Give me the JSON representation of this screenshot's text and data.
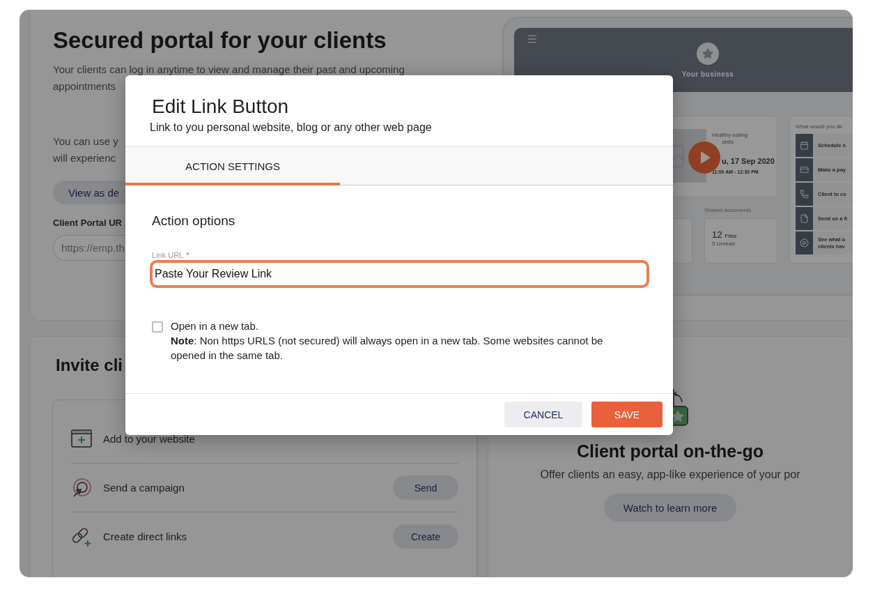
{
  "portal": {
    "title": "Secured portal for your clients",
    "intro_lines": [
      "Your clients can log in anytime to view and manage their past and upcoming",
      "appointments"
    ],
    "usage_lines": [
      "You can use y",
      "will experienc"
    ],
    "demo_button": "View as de",
    "url_label": "Client Portal UR",
    "url_field": {
      "value": "https://emp.th"
    }
  },
  "preview": {
    "business": "Your business",
    "video": {
      "caption_lines": [
        "Healthy eating",
        "abits"
      ],
      "date": "u, 17 Sep 2020",
      "time": "11:00 AM - 12:30 PM"
    },
    "documents": {
      "label": "Shared documents",
      "count": "12",
      "unit": "Files",
      "unread": "5 Unread"
    },
    "actions_title": "What would you lik",
    "actions": [
      {
        "lines": [
          "Schedule n"
        ]
      },
      {
        "lines": [
          "Make a pay"
        ]
      },
      {
        "lines": [
          "Client to co"
        ]
      },
      {
        "lines": [
          "Send us a fi"
        ]
      },
      {
        "lines": [
          "See what o",
          "clients hav"
        ]
      }
    ]
  },
  "invite": {
    "title": "Invite cli",
    "rows": [
      {
        "label": "Add to your website"
      },
      {
        "label": "Send a campaign",
        "button": "Send"
      },
      {
        "label": "Create direct links",
        "button": "Create"
      }
    ]
  },
  "app_promo": {
    "title": "Client portal on-the-go",
    "text": "Offer clients an easy, app-like experience of your por",
    "button": "Watch to learn more"
  },
  "dialog": {
    "title": "Edit Link Button",
    "subtitle": "Link to you personal website, blog or any other web page",
    "tabs": [
      {
        "label": "ACTION SETTINGS",
        "selected": true
      }
    ],
    "section": "Action options",
    "url_field": {
      "label": "Link URL",
      "required_mark": "*",
      "value": "Paste Your Review Link",
      "focused": true
    },
    "new_tab": {
      "label": "Open in a new tab.",
      "checked": false,
      "note": "**Note**: Non https URLS (not secured) will always open in a new tab. Some websites cannot be opened in the same tab."
    },
    "buttons": [
      {
        "label": "CANCEL",
        "kind": "secondary"
      },
      {
        "label": "SAVE",
        "kind": "primary"
      }
    ]
  }
}
